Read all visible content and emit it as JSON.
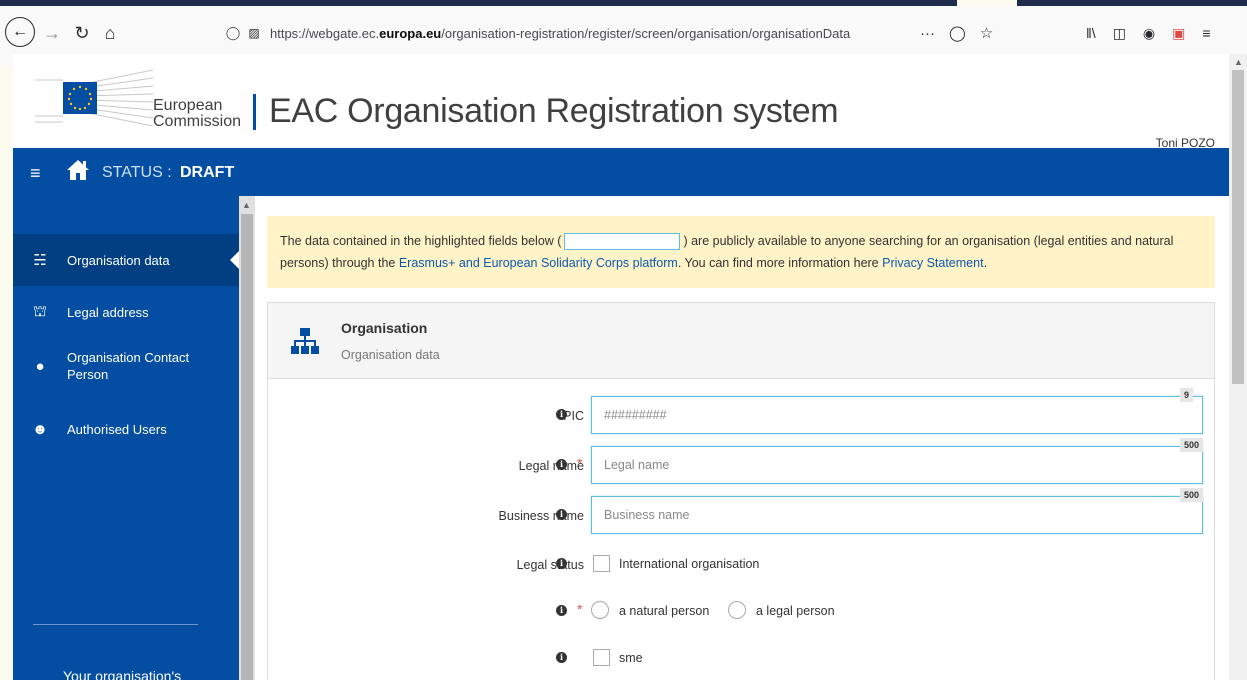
{
  "browser": {
    "url_prefix": "https://webgate.ec.",
    "url_domain": "europa.eu",
    "url_path": "/organisation-registration/register/screen/organisation/organisationData",
    "url_more": "···",
    "icons": [
      "back-icon",
      "forward-icon",
      "reload-icon",
      "home-icon",
      "tracking-shield-icon",
      "lock-icon",
      "page-actions-icon",
      "pocket-icon",
      "bookmark-star-icon",
      "library-icon",
      "sidebar-icon",
      "account-icon",
      "extension-icon",
      "menu-icon"
    ]
  },
  "header": {
    "ec_line1": "European",
    "ec_line2": "Commission",
    "title": "EAC Organisation Registration system",
    "user": "Toni POZO"
  },
  "topbar": {
    "burger": "≡",
    "status_label": "STATUS :",
    "status_value": "DRAFT"
  },
  "sidebar": {
    "items": [
      {
        "label": "Organisation data",
        "icon": "sitemap-icon",
        "active": true
      },
      {
        "label": "Legal address",
        "icon": "bank-icon"
      },
      {
        "label": "Organisation Contact Person",
        "icon": "user-icon"
      },
      {
        "label": "Authorised Users",
        "icon": "users-icon"
      }
    ],
    "footer": "Your organisation's"
  },
  "notice": {
    "text_before": "The data contained in the highlighted fields below (",
    "text_after": ") are publicly available to anyone searching for an organisation (legal entities and natural persons) through the",
    "link1": "Erasmus+ and European Solidarity Corps platform",
    "text_mid": ". You can find more information here",
    "link2": "Privacy Statement",
    "text_end": "."
  },
  "panel": {
    "title": "Organisation",
    "subtitle": "Organisation data"
  },
  "form": {
    "pic": {
      "label": "PIC",
      "placeholder": "#########",
      "counter": "9"
    },
    "legal_name": {
      "label": "Legal name",
      "placeholder": "Legal name",
      "counter": "500",
      "required": "*"
    },
    "business_name": {
      "label": "Business name",
      "placeholder": "Business name",
      "counter": "500"
    },
    "legal_status": {
      "label": "Legal status",
      "option": "International organisation"
    },
    "person_type": {
      "required": "*",
      "option1": "a natural person",
      "option2": "a legal person"
    },
    "sme": {
      "option": "sme"
    },
    "info_glyph": "i"
  },
  "colors": {
    "primary": "#034ea2",
    "notice_bg": "#fff3c7",
    "highlight_border": "#5bc0de",
    "required": "#d9534f"
  }
}
